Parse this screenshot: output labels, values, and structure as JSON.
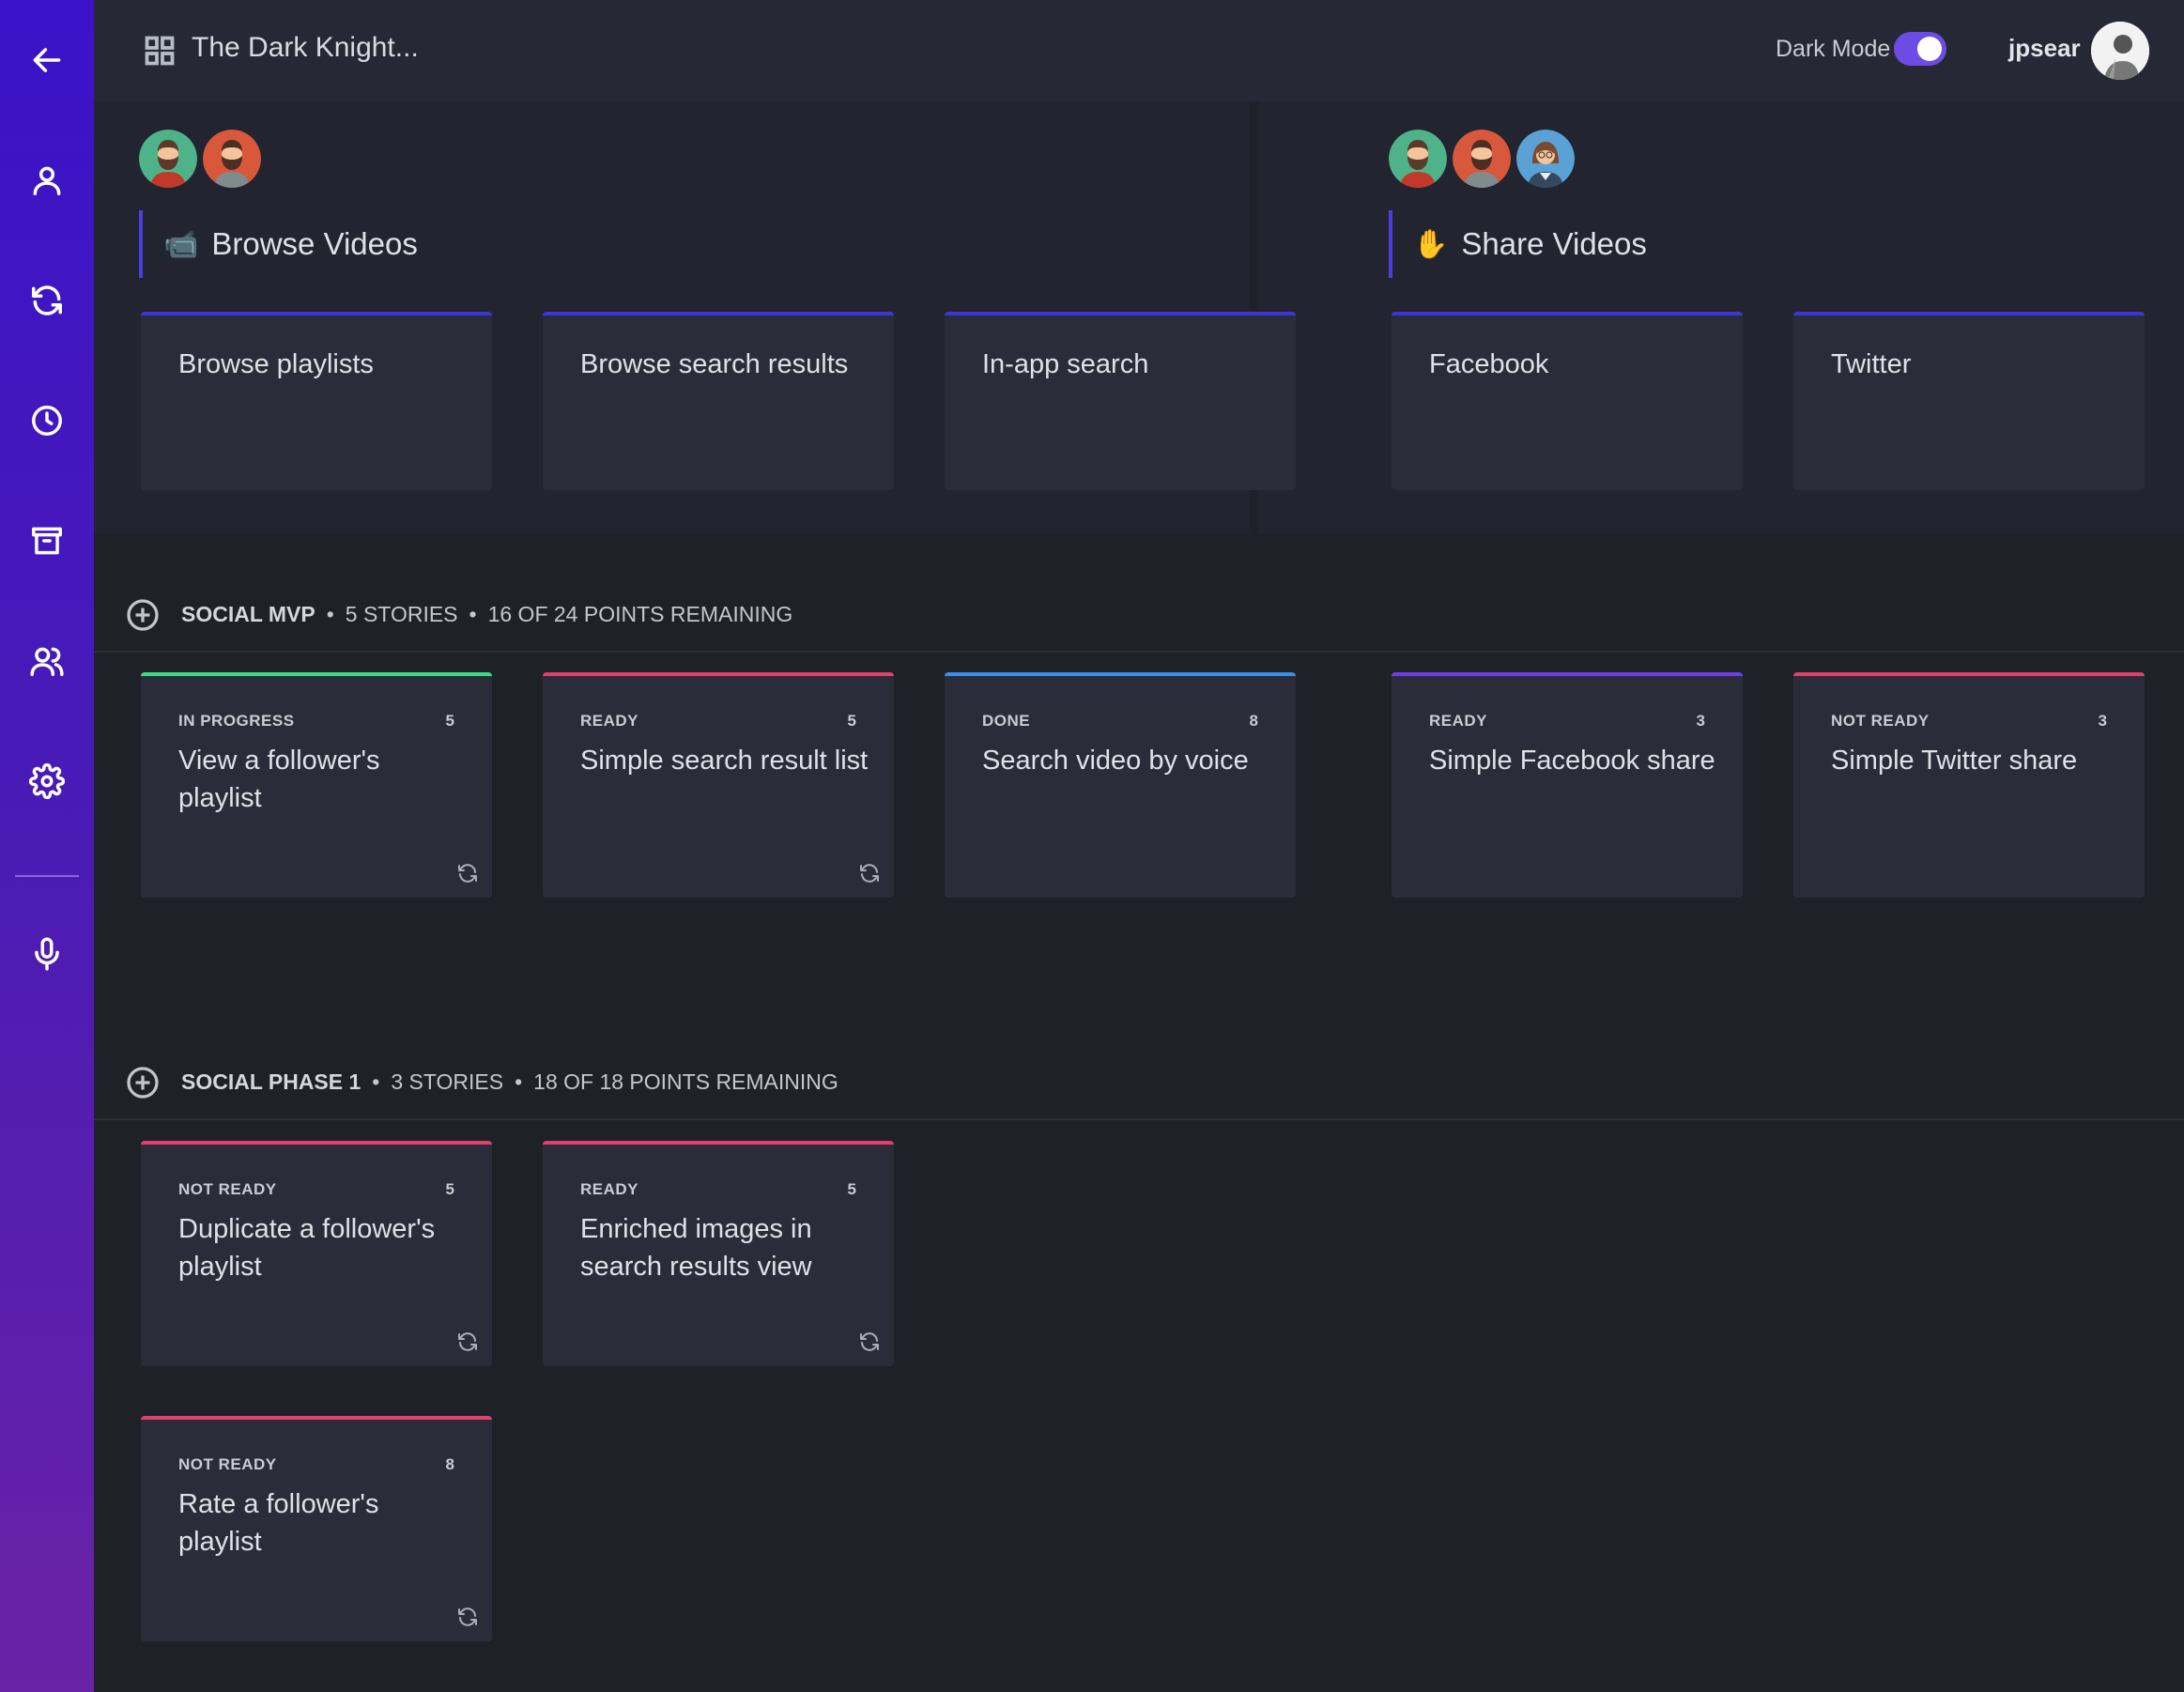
{
  "header": {
    "board_title": "The Dark Knight...",
    "dark_mode_label": "Dark Mode",
    "dark_mode_on": true,
    "username": "jpsear"
  },
  "colors": {
    "accent": "#3c35d8",
    "toggle": "#6d4ce6",
    "status_in_progress": "#3ddc84",
    "status_ready": "#e0406a",
    "status_done": "#3b8fe8",
    "status_ready_alt": "#6b3ee8",
    "status_not_ready": "#e0406a"
  },
  "epics": [
    {
      "emoji": "📹",
      "title": "Browse Videos",
      "avatars": [
        "bearded-man-avatar",
        "bearded-man-avatar"
      ],
      "features": [
        "Browse playlists",
        "Browse search results",
        "In-app search"
      ]
    },
    {
      "emoji": "✋",
      "title": "Share Videos",
      "avatars": [
        "bearded-man-avatar",
        "bearded-man-avatar",
        "woman-avatar"
      ],
      "features": [
        "Facebook",
        "Twitter"
      ]
    }
  ],
  "releases": [
    {
      "name": "SOCIAL MVP",
      "stories_count": "5 STORIES",
      "points_remaining": "16 OF 24 POINTS REMAINING",
      "stories": [
        {
          "status": "IN PROGRESS",
          "points": "5",
          "title": "View a follower's playlist",
          "synced": true
        },
        {
          "status": "READY",
          "points": "5",
          "title": "Simple search result list",
          "synced": true
        },
        {
          "status": "DONE",
          "points": "8",
          "title": "Search video by voice",
          "synced": false
        },
        {
          "status": "READY",
          "points": "3",
          "title": "Simple Facebook share",
          "synced": false
        },
        {
          "status": "NOT READY",
          "points": "3",
          "title": "Simple Twitter share",
          "synced": false
        }
      ]
    },
    {
      "name": "SOCIAL PHASE 1",
      "stories_count": "3 STORIES",
      "points_remaining": "18 OF 18 POINTS REMAINING",
      "stories": [
        {
          "status": "NOT READY",
          "points": "5",
          "title": "Duplicate a follower's playlist",
          "synced": true
        },
        {
          "status": "READY",
          "points": "5",
          "title": "Enriched images in search results view",
          "synced": true
        },
        {
          "status": "NOT READY",
          "points": "8",
          "title": "Rate a follower's playlist",
          "synced": true
        }
      ]
    }
  ],
  "sidebar": {
    "items": [
      "back-arrow-icon",
      "user-icon",
      "sync-icon",
      "clock-icon",
      "archive-icon",
      "team-icon",
      "gear-icon",
      "microphone-icon"
    ]
  }
}
